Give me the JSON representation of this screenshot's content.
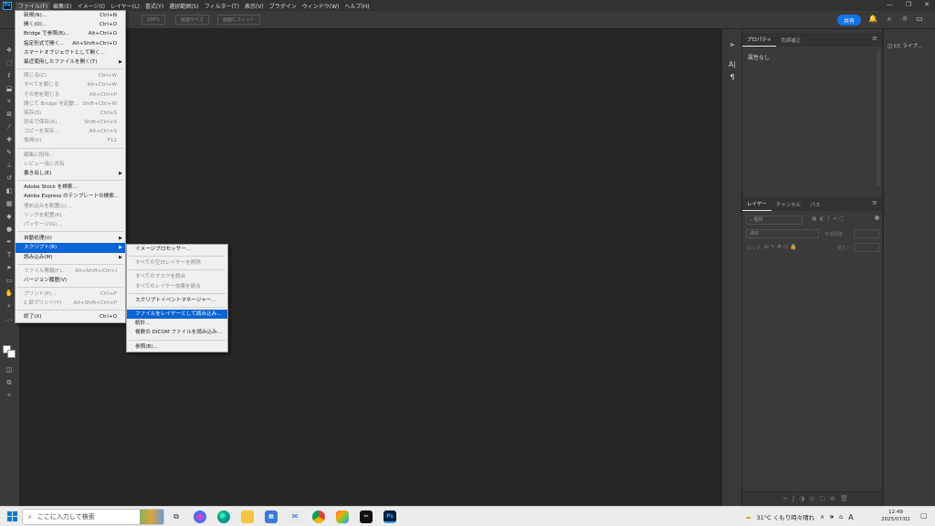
{
  "menubar": {
    "items": [
      "ファイル(F)",
      "編集(E)",
      "イメージ(I)",
      "レイヤー(L)",
      "書式(Y)",
      "選択範囲(S)",
      "フィルター(T)",
      "表示(V)",
      "プラグイン",
      "ウィンドウ(W)",
      "ヘルプ(H)"
    ],
    "app_icon": "Ps"
  },
  "options_bar": {
    "buttons": [
      "100%",
      "画面サイズ",
      "画面にフィット"
    ],
    "share_label": "共有"
  },
  "file_menu": [
    {
      "label": "新規(N)...",
      "shortcut": "Ctrl+N"
    },
    {
      "label": "開く(O)...",
      "shortcut": "Ctrl+O"
    },
    {
      "label": "Bridge で参照(B)...",
      "shortcut": "Alt+Ctrl+O"
    },
    {
      "label": "指定形式で開く...",
      "shortcut": "Alt+Shift+Ctrl+O"
    },
    {
      "label": "スマートオブジェクトとして開く..."
    },
    {
      "label": "最近使用したファイルを開く(T)",
      "submenu": true
    },
    {
      "sep": true
    },
    {
      "label": "閉じる(C)",
      "shortcut": "Ctrl+W",
      "disabled": true
    },
    {
      "label": "すべてを閉じる",
      "shortcut": "Alt+Ctrl+W",
      "disabled": true
    },
    {
      "label": "その他を閉じる",
      "shortcut": "Alt+Ctrl+P",
      "disabled": true
    },
    {
      "label": "閉じて Bridge を起動...",
      "shortcut": "Shift+Ctrl+W",
      "disabled": true
    },
    {
      "label": "保存(S)",
      "shortcut": "Ctrl+S",
      "disabled": true
    },
    {
      "label": "別名で保存(A)...",
      "shortcut": "Shift+Ctrl+S",
      "disabled": true
    },
    {
      "label": "コピーを保存...",
      "shortcut": "Alt+Ctrl+S",
      "disabled": true
    },
    {
      "label": "復帰(V)",
      "shortcut": "F12",
      "disabled": true
    },
    {
      "sep": true
    },
    {
      "label": "編集に招待...",
      "disabled": true
    },
    {
      "label": "レビュー用に共有",
      "disabled": true
    },
    {
      "label": "書き出し(E)",
      "submenu": true
    },
    {
      "sep": true
    },
    {
      "label": "Adobe Stock を検索..."
    },
    {
      "label": "Adobe Express のテンプレートの検索..."
    },
    {
      "label": "埋め込みを配置(L)...",
      "disabled": true
    },
    {
      "label": "リンクを配置(K)...",
      "disabled": true
    },
    {
      "label": "パッケージ(G)...",
      "disabled": true
    },
    {
      "sep": true
    },
    {
      "label": "自動処理(U)",
      "submenu": true
    },
    {
      "label": "スクリプト(R)",
      "submenu": true,
      "highlight": true
    },
    {
      "label": "読み込み(M)",
      "submenu": true
    },
    {
      "sep": true
    },
    {
      "label": "ファイル情報(F)...",
      "shortcut": "Alt+Shift+Ctrl+I",
      "disabled": true
    },
    {
      "label": "バージョン履歴(V)"
    },
    {
      "sep": true
    },
    {
      "label": "プリント(P)...",
      "shortcut": "Ctrl+P",
      "disabled": true
    },
    {
      "label": "1 部プリント(Y)",
      "shortcut": "Alt+Shift+Ctrl+P",
      "disabled": true
    },
    {
      "sep": true
    },
    {
      "label": "終了(X)",
      "shortcut": "Ctrl+Q"
    }
  ],
  "script_submenu": [
    {
      "label": "イメージプロセッサー..."
    },
    {
      "sep": true
    },
    {
      "label": "すべての空白レイヤーを削除",
      "disabled": true
    },
    {
      "sep": true
    },
    {
      "label": "すべてのマスクを統合",
      "disabled": true
    },
    {
      "label": "すべてのレイヤー効果を統合",
      "disabled": true
    },
    {
      "sep": true
    },
    {
      "label": "スクリプトイベントマネージャー..."
    },
    {
      "sep": true
    },
    {
      "label": "ファイルをレイヤーとして読み込み...",
      "highlight": true
    },
    {
      "label": "統計..."
    },
    {
      "label": "複数の DICOM ファイルを読み込み..."
    },
    {
      "sep": true
    },
    {
      "label": "参照(B)..."
    }
  ],
  "properties_panel": {
    "tabs": [
      "プロパティ",
      "色調補正"
    ],
    "empty_text": "属性なし"
  },
  "layers_panel": {
    "tabs": [
      "レイヤー",
      "チャンネル",
      "パス"
    ],
    "filter_placeholder": "種類",
    "blend_mode": "通常",
    "opacity_label": "不透明度：",
    "lock_label": "ロック：",
    "fill_label": "塗り："
  },
  "cc_panel": {
    "label": "CC ライブ..."
  },
  "taskbar": {
    "search_placeholder": "ここに入力して検索",
    "weather": "31°C くもり時々晴れ",
    "ime": "A",
    "time": "12:49",
    "date": "2025/07/02"
  },
  "colors": {
    "menu_highlight": "#0b64d6",
    "share_button": "#1473e6",
    "ps_blue": "#31a8ff"
  }
}
